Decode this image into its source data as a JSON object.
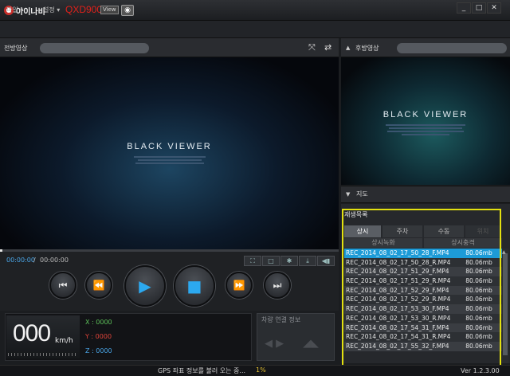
{
  "app": {
    "brand": "아이나비",
    "model": "QXD900",
    "view_badge": "View",
    "camera_icon": "camera-icon",
    "window_controls": [
      "_",
      "□",
      "✕"
    ]
  },
  "menu": {
    "items": [
      {
        "label": "파일 ▾"
      },
      {
        "label": "설정 ▾"
      }
    ]
  },
  "front": {
    "label": "전방영상",
    "video_title": "BLACK VIEWER",
    "icons": [
      "expand-icon",
      "swap-icon"
    ]
  },
  "rear": {
    "label": "후방영상",
    "video_title": "BLACK VIEWER"
  },
  "controls": {
    "time_current": "00:00:00",
    "time_sep": "/",
    "time_total": "00:00:00",
    "small_buttons": [
      "capture-icon",
      "fullscreen-icon",
      "settings-icon",
      "download-icon",
      "volume-icon"
    ],
    "playback": [
      "skip-back-icon",
      "rewind-icon",
      "play-icon",
      "stop-icon",
      "fast-forward-icon",
      "skip-forward-icon"
    ]
  },
  "telemetry": {
    "speed": "000",
    "speed_unit": "km/h",
    "x": "X : 0000",
    "y": "Y : 0000",
    "z": "Z : 0000",
    "vehicle_info_label": "차량 연결 정보"
  },
  "map": {
    "label": "지도"
  },
  "playlist": {
    "title": "재생목록",
    "tabs": [
      {
        "label": "상시",
        "active": true
      },
      {
        "label": "주차",
        "active": false
      },
      {
        "label": "수동",
        "active": false
      },
      {
        "label": "위치",
        "active": false
      }
    ],
    "columns": [
      "상시녹화",
      "상시충격"
    ],
    "rows": [
      {
        "name": "REC_2014_08_02_17_50_28_F.MP4",
        "size": "80.06mb",
        "selected": true
      },
      {
        "name": "REC_2014_08_02_17_50_28_R.MP4",
        "size": "80.06mb"
      },
      {
        "name": "REC_2014_08_02_17_51_29_F.MP4",
        "size": "80.06mb"
      },
      {
        "name": "REC_2014_08_02_17_51_29_R.MP4",
        "size": "80.06mb"
      },
      {
        "name": "REC_2014_08_02_17_52_29_F.MP4",
        "size": "80.06mb"
      },
      {
        "name": "REC_2014_08_02_17_52_29_R.MP4",
        "size": "80.06mb"
      },
      {
        "name": "REC_2014_08_02_17_53_30_F.MP4",
        "size": "80.06mb"
      },
      {
        "name": "REC_2014_08_02_17_53_30_R.MP4",
        "size": "80.06mb"
      },
      {
        "name": "REC_2014_08_02_17_54_31_F.MP4",
        "size": "80.06mb"
      },
      {
        "name": "REC_2014_08_02_17_54_31_R.MP4",
        "size": "80.06mb"
      },
      {
        "name": "REC_2014_08_02_17_55_32_F.MP4",
        "size": "80.06mb"
      }
    ]
  },
  "status": {
    "text": "GPS 좌표 정보를 불러 오는 중...",
    "percent": "1%",
    "version": "Ver 1.2.3.00"
  },
  "colors": {
    "accent": "#1d9bd7",
    "brand_red": "#e0211b",
    "highlight": "#e3e010",
    "y_axis": "#e0443a",
    "axis": "#4aa6e8"
  }
}
